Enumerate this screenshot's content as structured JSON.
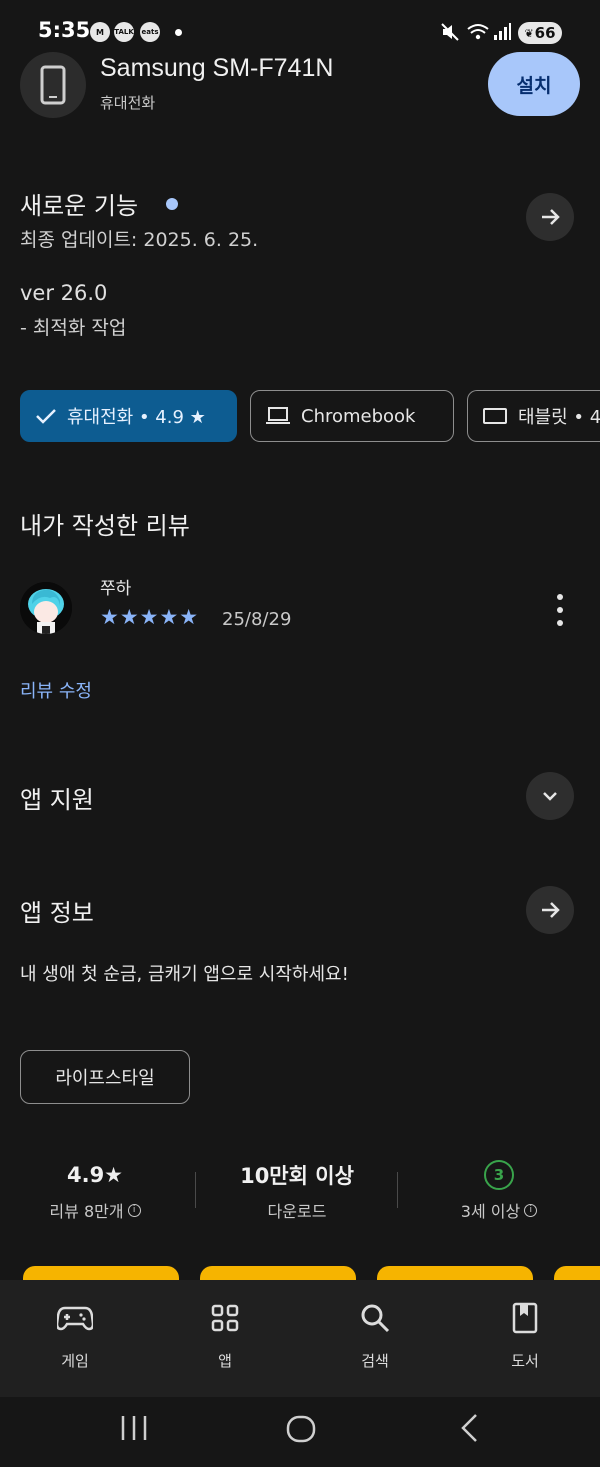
{
  "status_bar": {
    "time": "5:35",
    "notif_icons": [
      "M",
      "TALK",
      "eats"
    ],
    "battery": "66"
  },
  "app": {
    "name": "Samsung SM-F741N",
    "subtitle": "휴대전화",
    "install_label": "설치"
  },
  "whats_new": {
    "title": "새로운 기능",
    "last_updated": "최종 업데이트: 2025. 6. 25.",
    "version": "ver 26.0",
    "notes": "- 최적화 작업"
  },
  "device_chips": [
    {
      "label": "휴대전화 • 4.9 ★",
      "selected": true
    },
    {
      "label": "Chromebook",
      "selected": false
    },
    {
      "label": "태블릿 • 4",
      "selected": false
    }
  ],
  "my_review": {
    "heading": "내가 작성한 리뷰",
    "reviewer": "쭈하",
    "stars": "★★★★★",
    "rating": 5,
    "date": "25/8/29",
    "edit_label": "리뷰 수정"
  },
  "app_support": {
    "title": "앱 지원"
  },
  "app_info": {
    "title": "앱 정보",
    "description": "내 생애 첫 순금, 금캐기 앱으로 시작하세요!",
    "tag": "라이프스타일"
  },
  "stats": {
    "rating_value": "4.9★",
    "rating_label": "리뷰 8만개",
    "downloads_value": "10만회 이상",
    "downloads_label": "다운로드",
    "age_value": "3",
    "age_label": "3세 이상"
  },
  "bottom_nav": [
    {
      "label": "게임",
      "icon": "gamepad-icon"
    },
    {
      "label": "앱",
      "icon": "apps-grid-icon"
    },
    {
      "label": "검색",
      "icon": "search-icon"
    },
    {
      "label": "도서",
      "icon": "book-icon"
    }
  ],
  "colors": {
    "background": "#161616",
    "accent": "#a8c7fa",
    "selected_chip": "#0d5c91",
    "age_badge": "#39a44b",
    "card": "#f6b400"
  }
}
